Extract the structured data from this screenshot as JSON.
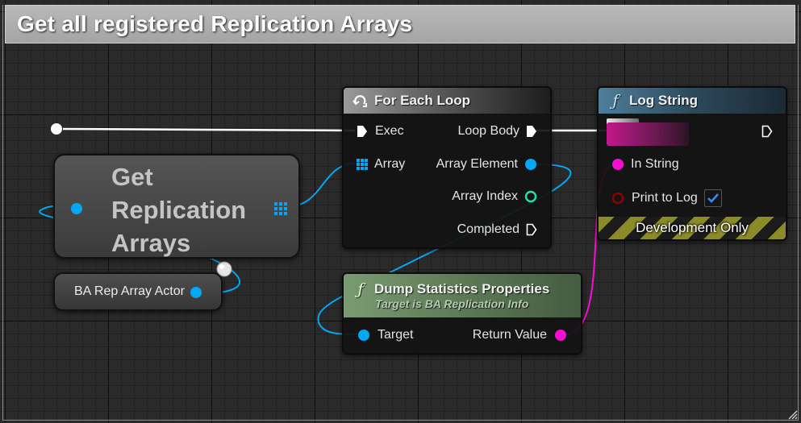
{
  "comment": {
    "title": "Get all registered Replication Arrays"
  },
  "nodes": {
    "get_replication_arrays": {
      "title_lines": [
        "Get",
        "Replication",
        "Arrays"
      ]
    },
    "ba_rep_array_actor": {
      "label": "BA Rep Array Actor"
    },
    "for_each_loop": {
      "title": "For Each Loop",
      "pins": {
        "exec": "Exec",
        "array": "Array",
        "loop_body": "Loop Body",
        "array_element": "Array Element",
        "array_index": "Array Index",
        "completed": "Completed"
      }
    },
    "log_string": {
      "title": "Log String",
      "pins": {
        "in_string": "In String",
        "print_to_log": "Print to Log"
      },
      "print_to_log_checked": true,
      "footer": "Development Only"
    },
    "dump_statistics": {
      "title": "Dump Statistics Properties",
      "subtitle": "Target is BA Replication Info",
      "pins": {
        "target": "Target",
        "return_value": "Return Value"
      }
    }
  },
  "colors": {
    "exec_wire": "#ffffff",
    "object_pin": "#00a8f4",
    "string_pin": "#f70fd0",
    "int_pin": "#1fe3a4",
    "bool_pin": "#8c0000"
  },
  "icons": {
    "loop": "loop-arrows-icon",
    "function": "function-f-icon",
    "array": "array-grid-icon",
    "checkmark": "checkmark-icon"
  }
}
